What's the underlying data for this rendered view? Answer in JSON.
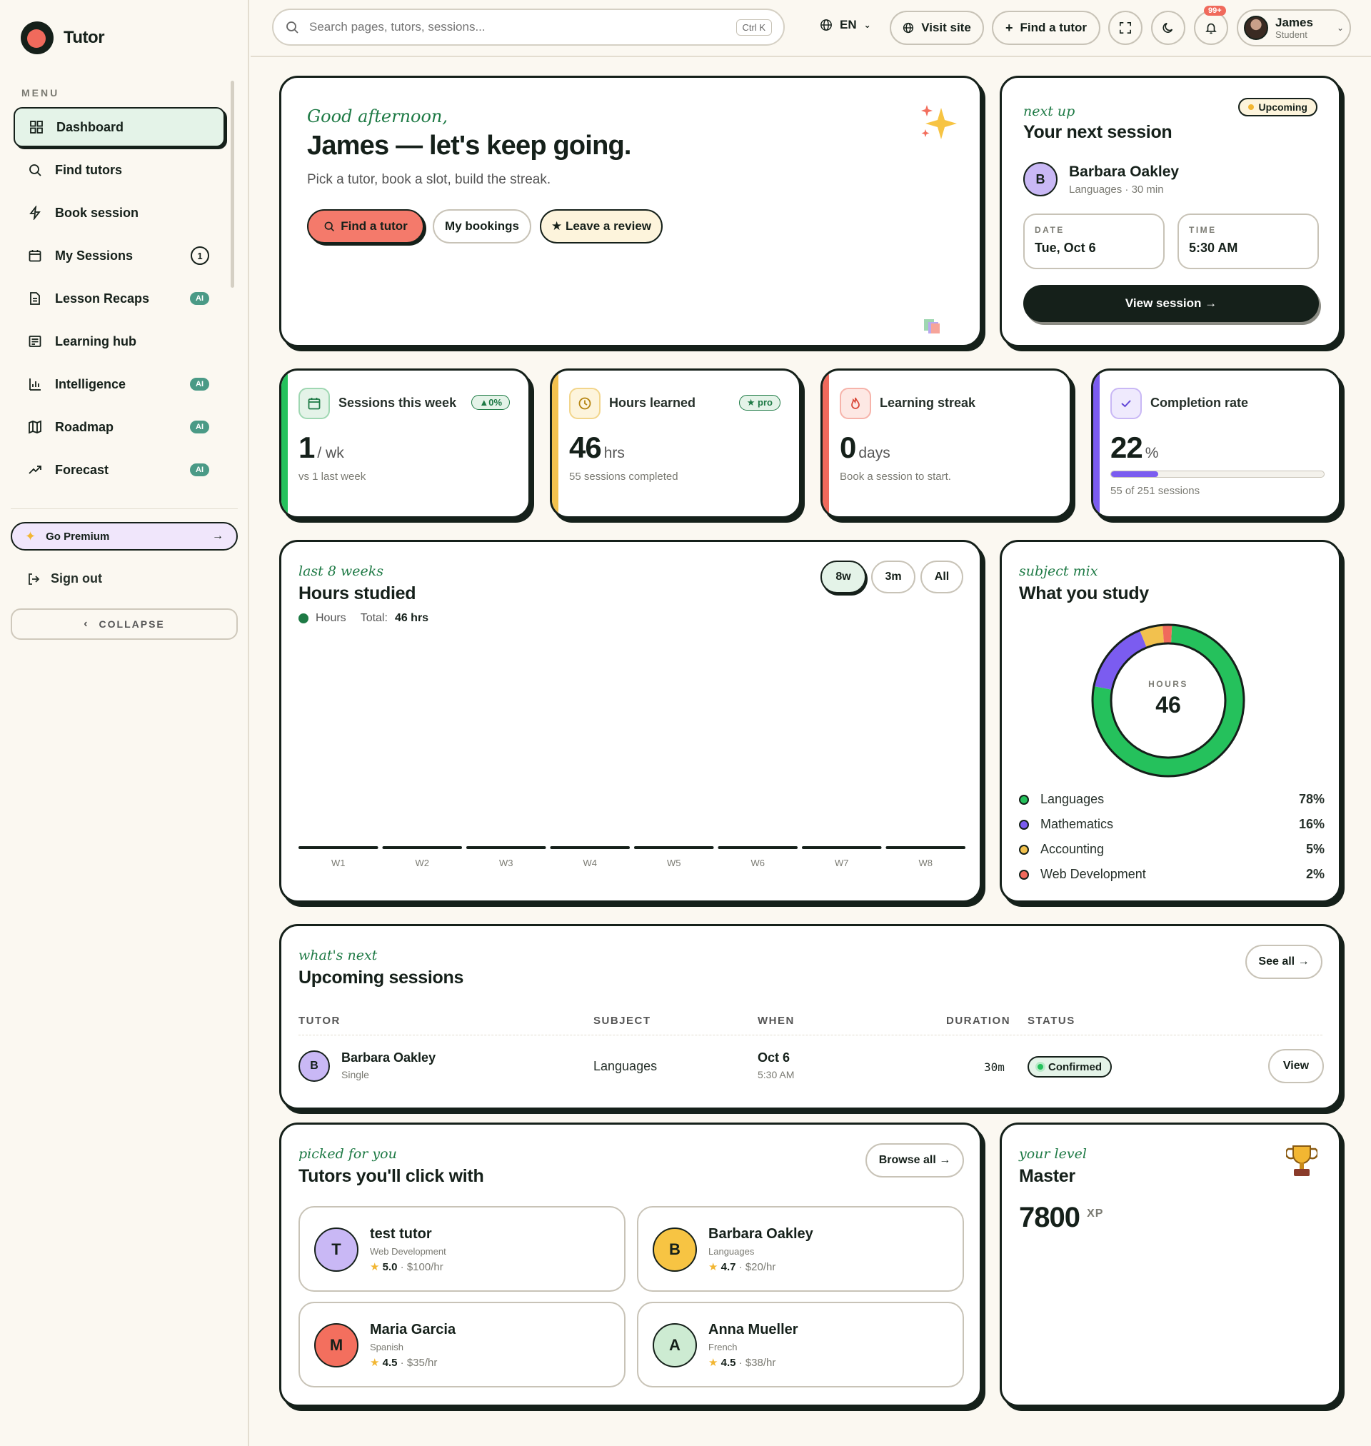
{
  "brand": {
    "name": "Tutor"
  },
  "sidebar": {
    "menu_label": "MENU",
    "items": [
      {
        "label": "Dashboard",
        "icon": "grid-icon"
      },
      {
        "label": "Find tutors",
        "icon": "search-icon"
      },
      {
        "label": "Book session",
        "icon": "bolt-icon"
      },
      {
        "label": "My Sessions",
        "icon": "calendar-icon",
        "count": "1"
      },
      {
        "label": "Lesson Recaps",
        "icon": "document-icon",
        "badge": "AI"
      },
      {
        "label": "Learning hub",
        "icon": "book-icon"
      },
      {
        "label": "Intelligence",
        "icon": "bar-chart-icon",
        "badge": "AI"
      },
      {
        "label": "Roadmap",
        "icon": "map-icon",
        "badge": "AI"
      },
      {
        "label": "Forecast",
        "icon": "trend-icon",
        "badge": "AI"
      }
    ],
    "premium_label": "Go Premium",
    "signout_label": "Sign out",
    "collapse_label": "COLLAPSE"
  },
  "topbar": {
    "search_placeholder": "Search pages, tutors, sessions...",
    "search_shortcut": "Ctrl K",
    "language": "EN",
    "visit_site": "Visit site",
    "find_tutor": "Find a tutor",
    "notification_count": "99+",
    "user_name": "James",
    "user_role": "Student"
  },
  "hero": {
    "greeting": "Good afternoon,",
    "headline": "James — let's keep going.",
    "subtitle": "Pick a tutor, book a slot, build the streak.",
    "btn_find": "Find a tutor",
    "btn_bookings": "My bookings",
    "btn_review": "★ Leave a review"
  },
  "next_session": {
    "eyebrow": "next up",
    "title": "Your next session",
    "status": "Upcoming",
    "tutor_initial": "B",
    "tutor_name": "Barbara Oakley",
    "tutor_meta": "Languages · 30 min",
    "date_label": "DATE",
    "date_value": "Tue, Oct 6",
    "time_label": "TIME",
    "time_value": "5:30 AM",
    "button": "View session →"
  },
  "stats": [
    {
      "label": "Sessions this week",
      "badge": "▲0%",
      "value": "1",
      "unit": "/ wk",
      "sub": "vs 1 last week",
      "color": "#25c15c"
    },
    {
      "label": "Hours learned",
      "badge": "★ pro",
      "value": "46",
      "unit": "hrs",
      "sub": "55 sessions completed",
      "color": "#f2c14e"
    },
    {
      "label": "Learning streak",
      "value": "0",
      "unit": "days",
      "sub": "Book a session to start.",
      "color": "#f06a5c"
    },
    {
      "label": "Completion rate",
      "value": "22",
      "unit": "%",
      "sub": "55 of 251 sessions",
      "color": "#7b5cf0",
      "progress": 0.22
    }
  ],
  "hours_chart": {
    "eyebrow": "last 8 weeks",
    "title": "Hours studied",
    "legend": "Hours",
    "total_label": "Total:",
    "total_value": "46 hrs",
    "ranges": [
      "8w",
      "3m",
      "All"
    ]
  },
  "chart_data": [
    {
      "type": "bar",
      "title": "Hours studied",
      "categories": [
        "W1",
        "W2",
        "W3",
        "W4",
        "W5",
        "W6",
        "W7",
        "W8"
      ],
      "series": [
        {
          "name": "Hours",
          "values": [
            0,
            0,
            0,
            0,
            0,
            0,
            0,
            0
          ]
        }
      ],
      "legend": "top-left"
    },
    {
      "type": "pie",
      "title": "What you study",
      "center_label": "HOURS",
      "center_value": "46",
      "labels": [
        "Languages",
        "Mathematics",
        "Accounting",
        "Web Development"
      ],
      "values": [
        78,
        16,
        5,
        2
      ],
      "colors": [
        "#25c15c",
        "#7b5cf0",
        "#f2c14e",
        "#f06a5c"
      ]
    }
  ],
  "subject_mix": {
    "eyebrow": "subject mix",
    "title": "What you study",
    "center_label": "HOURS",
    "center_value": "46",
    "rows": [
      {
        "label": "Languages",
        "pct": "78%",
        "color": "#25c15c"
      },
      {
        "label": "Mathematics",
        "pct": "16%",
        "color": "#7b5cf0"
      },
      {
        "label": "Accounting",
        "pct": "5%",
        "color": "#f2c14e"
      },
      {
        "label": "Web Development",
        "pct": "2%",
        "color": "#f06a5c"
      }
    ]
  },
  "upcoming": {
    "eyebrow": "what's next",
    "title": "Upcoming sessions",
    "see_all": "See all →",
    "columns": [
      "TUTOR",
      "SUBJECT",
      "WHEN",
      "DURATION",
      "STATUS"
    ],
    "rows": [
      {
        "initial": "B",
        "tutor": "Barbara Oakley",
        "type": "Single",
        "subject": "Languages",
        "date": "Oct 6",
        "time": "5:30 AM",
        "duration": "30m",
        "status": "Confirmed",
        "action": "View"
      }
    ]
  },
  "tutors": {
    "eyebrow": "picked for you",
    "title": "Tutors you'll click with",
    "browse_all": "Browse all →",
    "items": [
      {
        "initial": "T",
        "name": "test tutor",
        "subject": "Web Development",
        "rating": "5.0",
        "price": " · $100/hr",
        "color": "#c9b8f5"
      },
      {
        "initial": "B",
        "name": "Barbara Oakley",
        "subject": "Languages",
        "rating": "4.7",
        "price": " · $20/hr",
        "color": "#f7c443"
      },
      {
        "initial": "M",
        "name": "Maria Garcia",
        "subject": "Spanish",
        "rating": "4.5",
        "price": " · $35/hr",
        "color": "#f36f5e"
      },
      {
        "initial": "A",
        "name": "Anna Mueller",
        "subject": "French",
        "rating": "4.5",
        "price": " · $38/hr",
        "color": "#cdebd2"
      }
    ]
  },
  "level": {
    "eyebrow": "your level",
    "title": "Master",
    "xp": "7800",
    "xp_unit": "XP"
  }
}
